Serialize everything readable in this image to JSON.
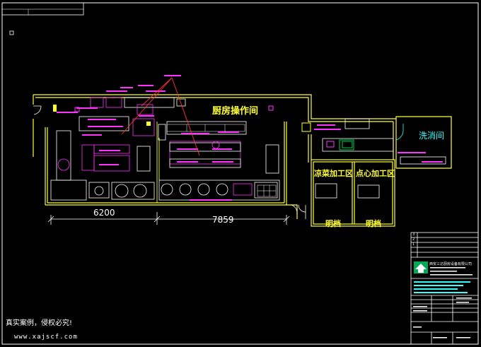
{
  "drawing": {
    "rooms": {
      "kitchen": "厨房操作间",
      "cold_dish": "凉菜加工区",
      "pastry": "点心加工区",
      "dishwash": "洗消间",
      "pass_window_1": "明档",
      "pass_window_2": "明档"
    },
    "dimensions": {
      "left": "6200",
      "right": "7859"
    },
    "title_block": {
      "rev_labels": [
        "3",
        "2",
        "1"
      ],
      "company": "西安三达厨房设备有限公司"
    },
    "watermark": {
      "notice": "真实案例，侵权必究!",
      "url": "www.xajscf.com"
    },
    "colors": {
      "wall": "#ffff33",
      "equipment": "#ff33ff",
      "fixture": "#ffffff",
      "accent": "#33ffff",
      "section": "#ff3333",
      "frame": "#ffffff",
      "background": "#000000"
    }
  }
}
